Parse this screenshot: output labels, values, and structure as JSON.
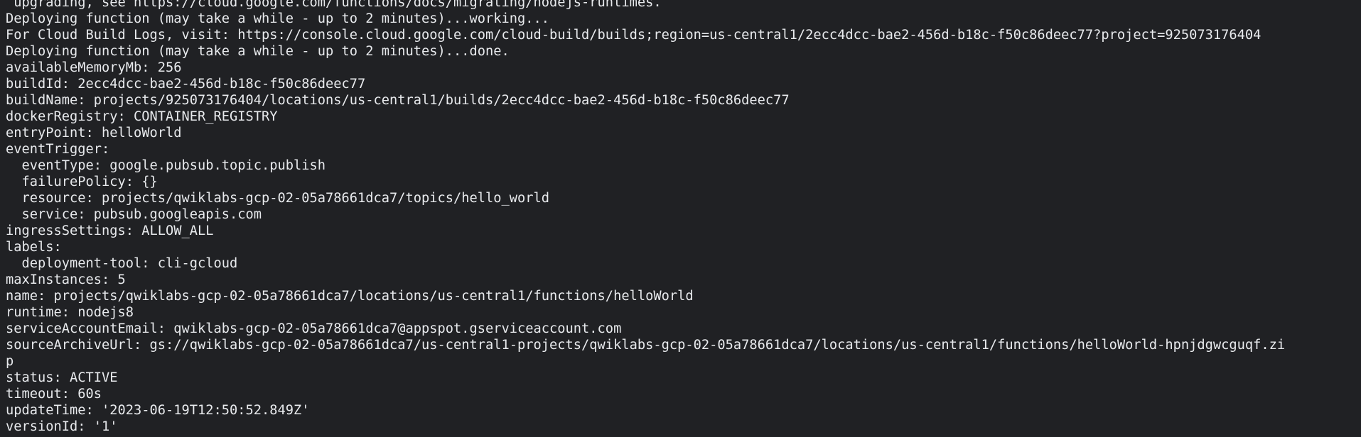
{
  "terminal": {
    "lines": [
      " upgrading, see https://cloud.google.com/functions/docs/migrating/nodejs-runtimes.",
      "Deploying function (may take a while - up to 2 minutes)...working...",
      "For Cloud Build Logs, visit: https://console.cloud.google.com/cloud-build/builds;region=us-central1/2ecc4dcc-bae2-456d-b18c-f50c86deec77?project=925073176404",
      "Deploying function (may take a while - up to 2 minutes)...done.",
      "availableMemoryMb: 256",
      "buildId: 2ecc4dcc-bae2-456d-b18c-f50c86deec77",
      "buildName: projects/925073176404/locations/us-central1/builds/2ecc4dcc-bae2-456d-b18c-f50c86deec77",
      "dockerRegistry: CONTAINER_REGISTRY",
      "entryPoint: helloWorld",
      "eventTrigger:",
      "  eventType: google.pubsub.topic.publish",
      "  failurePolicy: {}",
      "  resource: projects/qwiklabs-gcp-02-05a78661dca7/topics/hello_world",
      "  service: pubsub.googleapis.com",
      "ingressSettings: ALLOW_ALL",
      "labels:",
      "  deployment-tool: cli-gcloud",
      "maxInstances: 5",
      "name: projects/qwiklabs-gcp-02-05a78661dca7/locations/us-central1/functions/helloWorld",
      "runtime: nodejs8",
      "serviceAccountEmail: qwiklabs-gcp-02-05a78661dca7@appspot.gserviceaccount.com",
      "sourceArchiveUrl: gs://qwiklabs-gcp-02-05a78661dca7/us-central1-projects/qwiklabs-gcp-02-05a78661dca7/locations/us-central1/functions/helloWorld-hpnjdgwcguqf.zi",
      "p",
      "status: ACTIVE",
      "timeout: 60s",
      "updateTime: '2023-06-19T12:50:52.849Z'",
      "versionId: '1'"
    ]
  },
  "colors": {
    "background": "#202124",
    "text": "#e8eaed"
  }
}
